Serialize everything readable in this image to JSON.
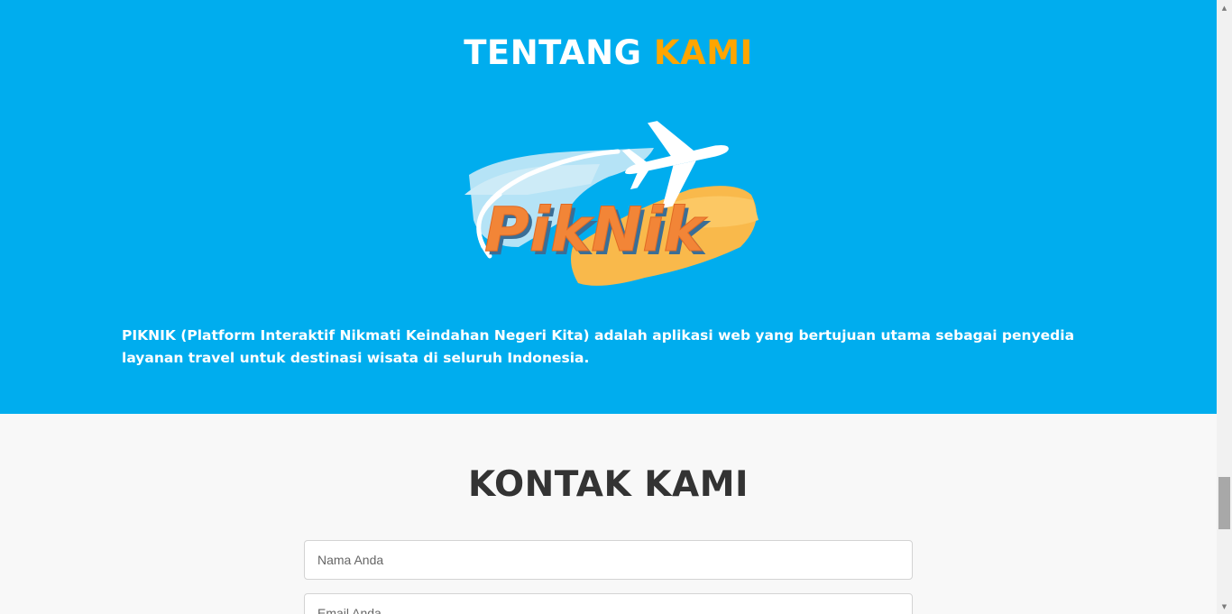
{
  "about": {
    "title_part1": "TENTANG",
    "title_part2": "KAMI",
    "logo_text": "PikNik",
    "description": "PIKNIK (Platform Interaktif Nikmati Keindahan Negeri Kita) adalah aplikasi web yang bertujuan utama sebagai penyedia layanan travel untuk destinasi wisata di seluruh Indonesia."
  },
  "contact": {
    "title": "KONTAK KAMI",
    "name_placeholder": "Nama Anda",
    "email_placeholder": "Email Anda"
  },
  "colors": {
    "about_bg": "#00adee",
    "accent": "#ffa500",
    "contact_bg": "#f8f8f8",
    "heading_dark": "#333333"
  },
  "icons": {
    "scroll_up": "triangle-up-icon",
    "scroll_down": "triangle-down-icon",
    "logo": "airplane-icon"
  }
}
